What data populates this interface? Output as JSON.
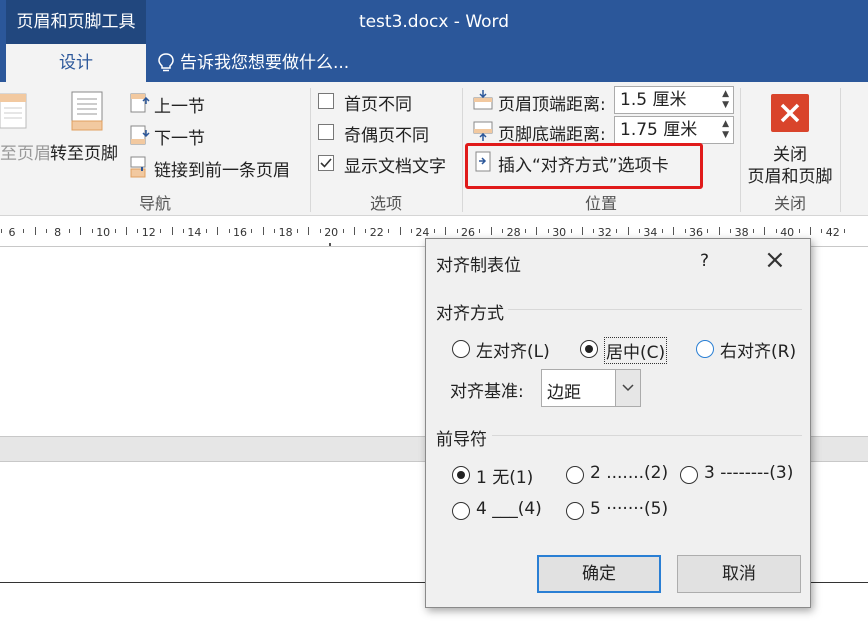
{
  "title_bar": {
    "context_tab": "页眉和页脚工具",
    "document_title": "test3.docx - Word"
  },
  "tabs": {
    "active": "设计",
    "tell_me": "告诉我您想要做什么..."
  },
  "ribbon": {
    "navigation": {
      "go_to_header_partial": "至页眉",
      "go_to_footer": "转至页脚",
      "previous": "上一节",
      "next": "下一节",
      "link_to_previous": "链接到前一条页眉",
      "group_label": "导航"
    },
    "options": {
      "different_first_page": "首页不同",
      "different_odd_even": "奇偶页不同",
      "show_document_text": "显示文档文字",
      "show_document_text_checked": true,
      "group_label": "选项"
    },
    "position": {
      "header_from_top_label": "页眉顶端距离:",
      "header_from_top_value": "1.5 厘米",
      "footer_from_bottom_label": "页脚底端距离:",
      "footer_from_bottom_value": "1.75 厘米",
      "insert_alignment_tab": "插入“对齐方式”选项卡",
      "group_label": "位置"
    },
    "close": {
      "button_line1": "关闭",
      "button_line2": "页眉和页脚",
      "group_label": "关闭"
    }
  },
  "ruler": {
    "ticks": [
      "6",
      "8",
      "10",
      "12",
      "14",
      "16",
      "18",
      "20",
      "22",
      "24",
      "26",
      "28",
      "30",
      "32",
      "34",
      "36",
      "38",
      "40",
      "42"
    ]
  },
  "dialog": {
    "title": "对齐制表位",
    "help": "?",
    "close": "×",
    "alignment_section": "对齐方式",
    "align_left": "左对齐(L)",
    "align_center": "居中(C)",
    "align_right": "右对齐(R)",
    "align_selected": "center",
    "align_relative_label": "对齐基准:",
    "align_relative_value": "边距",
    "leader_section": "前导符",
    "leader_1": "1 无(1)",
    "leader_2": "2 .......(2)",
    "leader_3": "3 --------(3)",
    "leader_4": "4 ___(4)",
    "leader_5": "5 ·······(5)",
    "leader_selected": "1",
    "ok_button": "确定",
    "cancel_button": "取消"
  },
  "colors": {
    "word_blue": "#2b579a",
    "highlight_red": "#e01a1a",
    "close_icon_red": "#d9442b",
    "focus_blue": "#2a7fd4"
  }
}
